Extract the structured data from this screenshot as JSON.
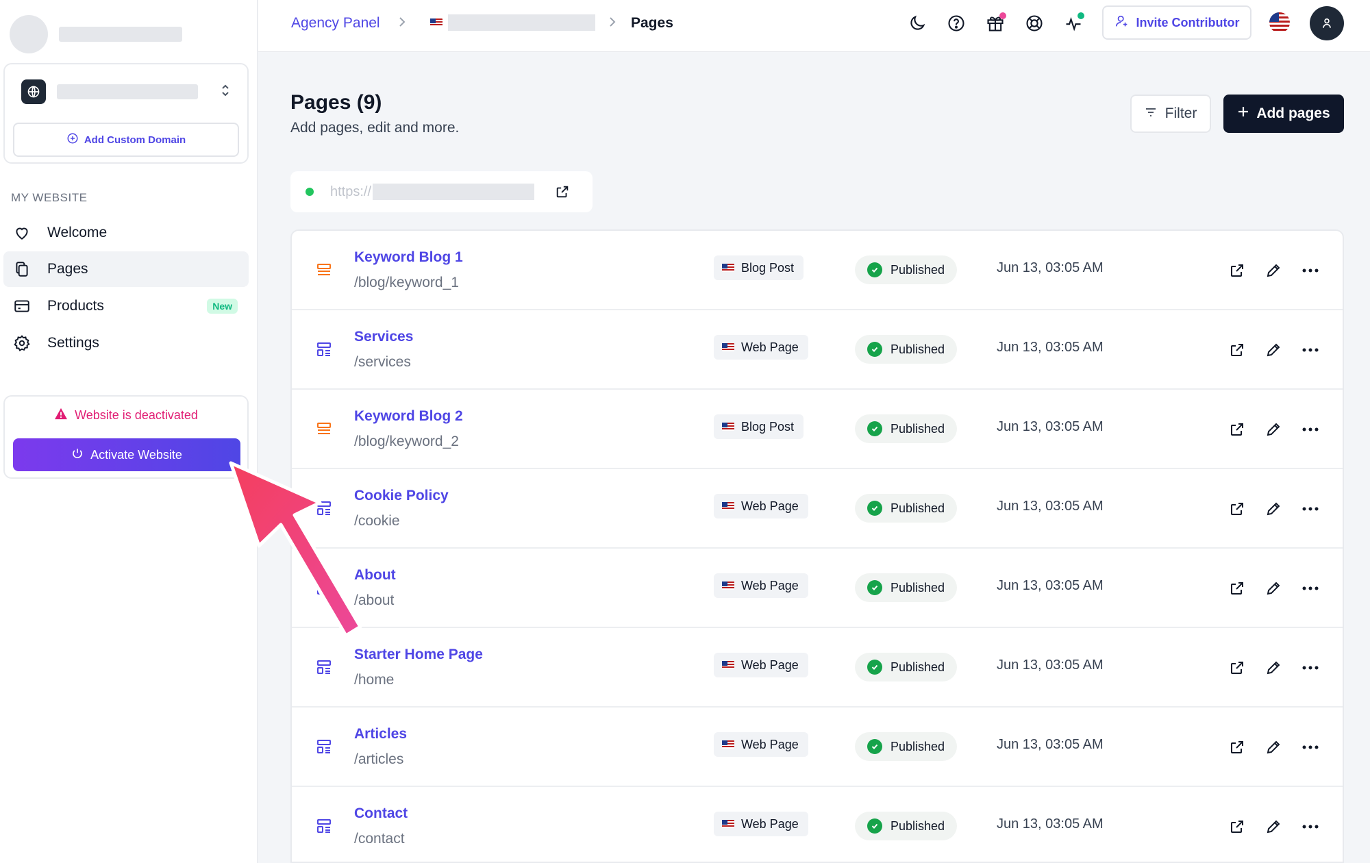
{
  "sidebar": {
    "add_domain_label": "Add Custom Domain",
    "section_label": "MY WEBSITE",
    "items": [
      {
        "label": "Welcome",
        "icon": "heart-icon"
      },
      {
        "label": "Pages",
        "icon": "pages-icon",
        "active": true
      },
      {
        "label": "Products",
        "icon": "credit-card-icon",
        "badge": "New"
      },
      {
        "label": "Settings",
        "icon": "gear-icon"
      }
    ],
    "deactivated_msg": "Website is deactivated",
    "activate_label": "Activate Website"
  },
  "header": {
    "breadcrumb": {
      "root": "Agency Panel",
      "current": "Pages"
    },
    "invite_label": "Invite Contributor",
    "icons": [
      "moon-icon",
      "help-icon",
      "gift-icon",
      "support-icon",
      "activity-icon"
    ]
  },
  "main": {
    "title": "Pages (9)",
    "subtitle": "Add pages, edit and more.",
    "filter_label": "Filter",
    "add_label": "Add pages",
    "url_prefix": "https://"
  },
  "pages": [
    {
      "title": "Keyword Blog 1",
      "slug": "/blog/keyword_1",
      "type": "Blog Post",
      "status": "Published",
      "date": "Jun 13, 03:05 AM",
      "kind": "blog"
    },
    {
      "title": "Services",
      "slug": "/services",
      "type": "Web Page",
      "status": "Published",
      "date": "Jun 13, 03:05 AM",
      "kind": "web"
    },
    {
      "title": "Keyword Blog 2",
      "slug": "/blog/keyword_2",
      "type": "Blog Post",
      "status": "Published",
      "date": "Jun 13, 03:05 AM",
      "kind": "blog"
    },
    {
      "title": "Cookie Policy",
      "slug": "/cookie",
      "type": "Web Page",
      "status": "Published",
      "date": "Jun 13, 03:05 AM",
      "kind": "web"
    },
    {
      "title": "About",
      "slug": "/about",
      "type": "Web Page",
      "status": "Published",
      "date": "Jun 13, 03:05 AM",
      "kind": "web"
    },
    {
      "title": "Starter Home Page",
      "slug": "/home",
      "type": "Web Page",
      "status": "Published",
      "date": "Jun 13, 03:05 AM",
      "kind": "web"
    },
    {
      "title": "Articles",
      "slug": "/articles",
      "type": "Web Page",
      "status": "Published",
      "date": "Jun 13, 03:05 AM",
      "kind": "web"
    },
    {
      "title": "Contact",
      "slug": "/contact",
      "type": "Web Page",
      "status": "Published",
      "date": "Jun 13, 03:05 AM",
      "kind": "web"
    }
  ],
  "colors": {
    "accent": "#4f46e5",
    "blog_icon": "#f97316",
    "published": "#16a34a",
    "deactivated": "#e11d74",
    "arrow": "#ef4470"
  }
}
